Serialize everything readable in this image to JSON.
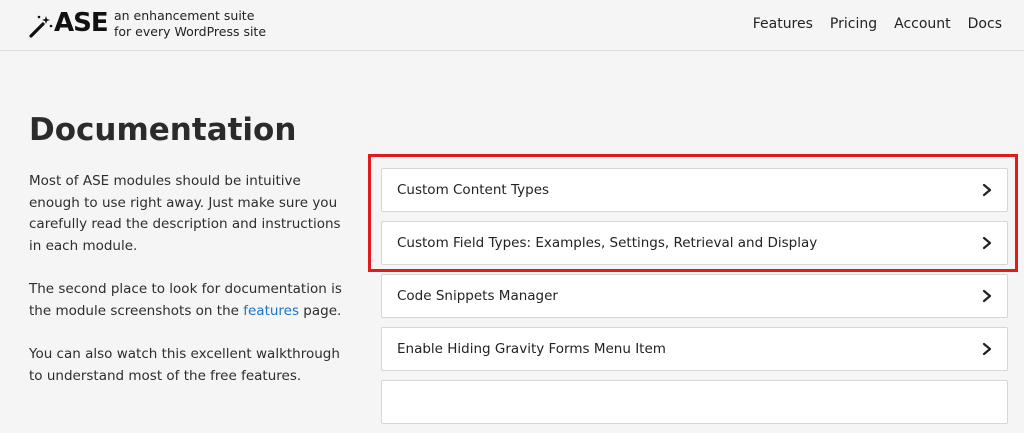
{
  "header": {
    "logo_text": "ASE",
    "tagline_line1": "an enhancement suite",
    "tagline_line2": "for every WordPress site",
    "nav": [
      "Features",
      "Pricing",
      "Account",
      "Docs"
    ]
  },
  "main": {
    "title": "Documentation",
    "intro": {
      "p1": "Most of ASE modules should be intuitive enough to use right away. Just make sure you carefully read the description and instructions in each module.",
      "p2_before": "The second place to look for documentation is the module screenshots on the ",
      "p2_link": "features",
      "p2_after": " page.",
      "p3": "You can also watch this excellent walkthrough to understand most of the free features."
    },
    "accordion": [
      {
        "label": "Custom Content Types"
      },
      {
        "label": "Custom Field Types: Examples, Settings, Retrieval and Display"
      },
      {
        "label": "Code Snippets Manager"
      },
      {
        "label": "Enable Hiding Gravity Forms Menu Item"
      }
    ]
  },
  "colors": {
    "highlight": "#e01b1b",
    "link": "#1a73c8",
    "background": "#f5f5f5"
  },
  "icons": {
    "logo": "magic-wand-icon",
    "accordion": "chevron-right-icon"
  }
}
